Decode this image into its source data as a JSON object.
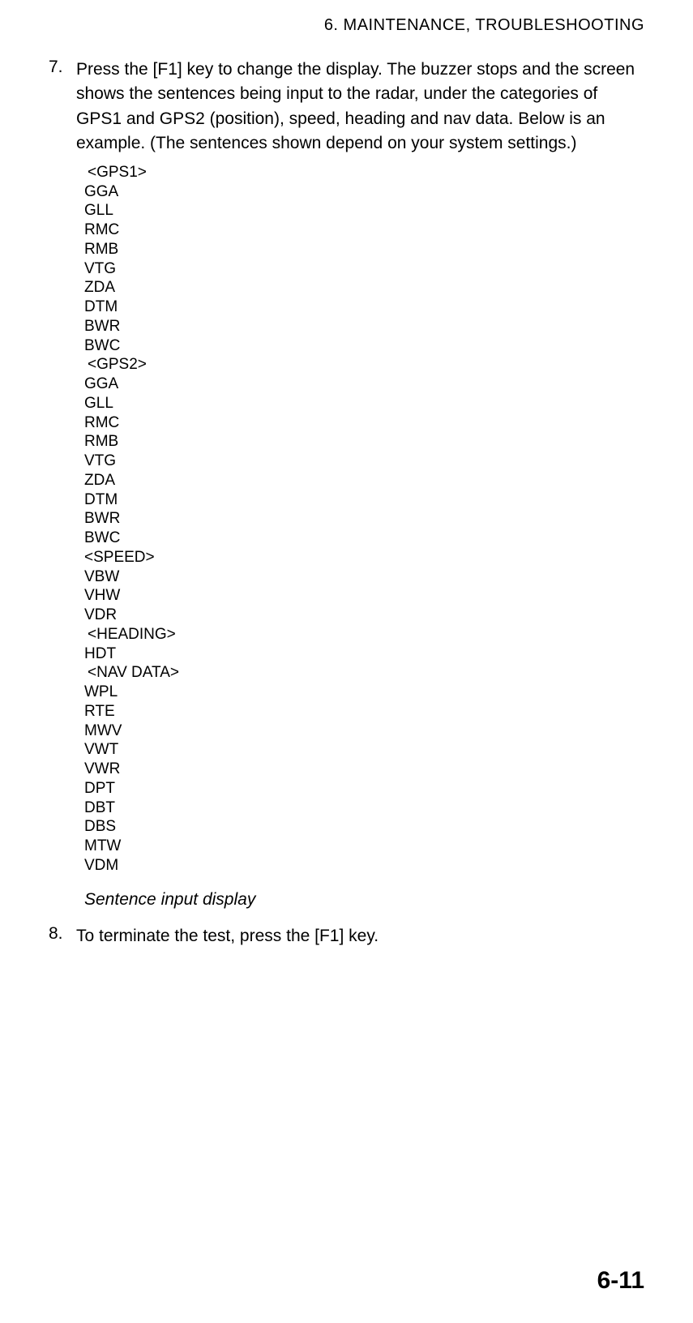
{
  "header": "6. MAINTENANCE, TROUBLESHOOTING",
  "item7": {
    "number": "7.",
    "text": "Press the [F1] key to change the display. The buzzer stops and the screen shows the sentences being input to the radar, under the categories of GPS1 and GPS2 (position), speed, heading and nav data. Below is an example. (The sentences shown depend on your system settings.)"
  },
  "sentences": {
    "gps1_header": "<GPS1>",
    "gps1_list": [
      "GGA",
      "GLL",
      "RMC",
      "RMB",
      "VTG",
      "ZDA",
      "DTM",
      "BWR",
      "BWC"
    ],
    "gps2_header": "<GPS2>",
    "gps2_list": [
      "GGA",
      "GLL",
      "RMC",
      "RMB",
      "VTG",
      "ZDA",
      "DTM",
      "BWR",
      "BWC"
    ],
    "speed_header": "<SPEED>",
    "speed_list": [
      "VBW",
      "VHW",
      "VDR"
    ],
    "heading_header": "<HEADING>",
    "heading_list": [
      "HDT"
    ],
    "nav_header": "<NAV DATA>",
    "nav_list": [
      "WPL",
      "RTE",
      "MWV",
      "VWT",
      "VWR",
      "DPT",
      "DBT",
      "DBS",
      "MTW",
      "VDM"
    ]
  },
  "caption": "Sentence input display",
  "item8": {
    "number": "8.",
    "text": "To terminate the test, press the [F1] key."
  },
  "page_number": "6-11"
}
